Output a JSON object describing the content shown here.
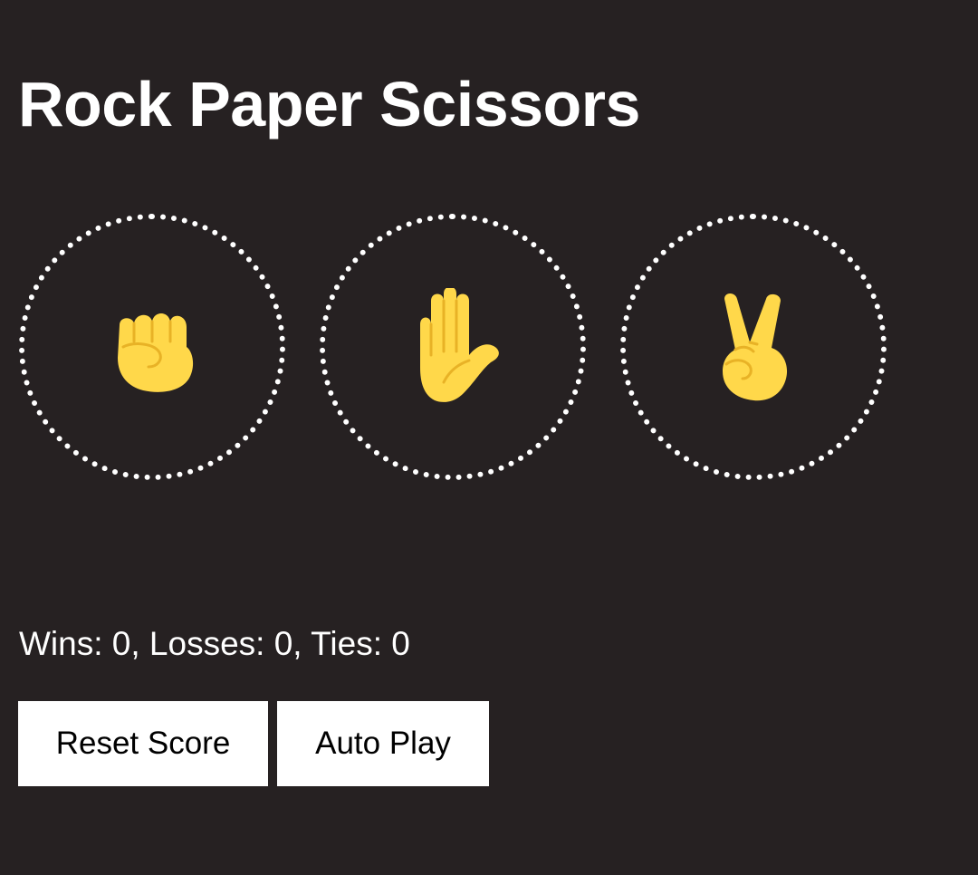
{
  "header": {
    "title": "Rock Paper Scissors"
  },
  "moves": [
    {
      "name": "rock",
      "icon": "raised-fist-icon"
    },
    {
      "name": "paper",
      "icon": "raised-hand-icon"
    },
    {
      "name": "scissors",
      "icon": "victory-hand-icon"
    }
  ],
  "score": {
    "text": "Wins: 0, Losses: 0, Ties: 0"
  },
  "controls": {
    "reset_label": "Reset Score",
    "autoplay_label": "Auto Play"
  },
  "colors": {
    "background": "#262122",
    "text": "#ffffff",
    "emoji_fill": "#FFD84A",
    "emoji_line": "#E8B226",
    "button_bg": "#ffffff",
    "button_text": "#000000"
  }
}
